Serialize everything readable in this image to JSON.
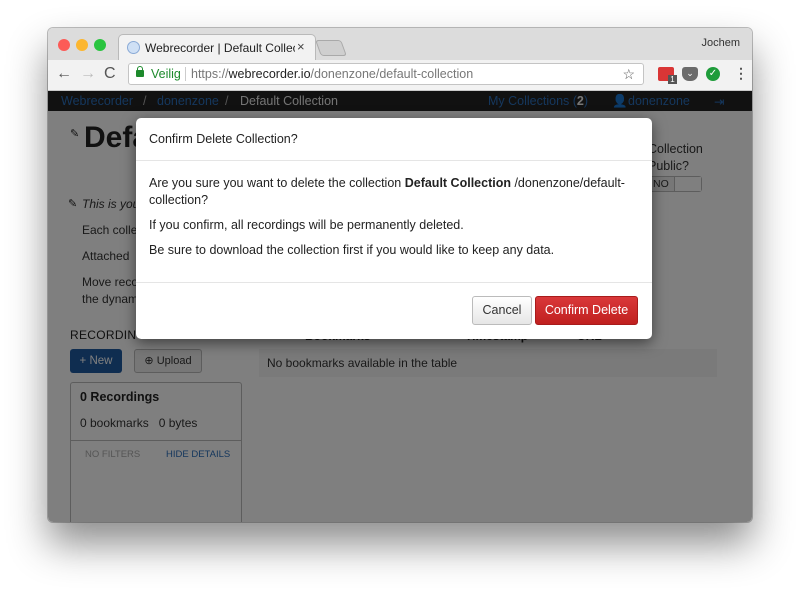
{
  "browser": {
    "tab_title": "Webrecorder | Default Collection",
    "tab_close": "×",
    "profile_name": "Jochem",
    "secure_label": "Veilig",
    "url_scheme": "https://",
    "url_host": "webrecorder.io",
    "url_path": "/donenzone/default-collection",
    "back_icon": "←",
    "forward_icon": "→",
    "reload_icon": "C",
    "star_icon": "☆",
    "menu_icon": "⋮",
    "extensions": [
      {
        "name": "calendar-extension",
        "badge": "1"
      },
      {
        "name": "pocket-extension",
        "glyph": "⌄"
      },
      {
        "name": "checkmark-extension",
        "glyph": "✓"
      }
    ]
  },
  "navbar": {
    "breadcrumbs": [
      "Webrecorder",
      "donenzone",
      "Default Collection"
    ],
    "separator": "/",
    "my_collections_label": "My Collections (",
    "my_collections_count": "2",
    "my_collections_close": ")",
    "user_label": "donenzone",
    "user_icon": "👤",
    "logout_icon": "⇥"
  },
  "page": {
    "title": "Default Collection",
    "description_italic": "This is your first collection",
    "desc_lines": [
      "Each collection",
      "Attached",
      "Move recordings",
      "the dynamic"
    ],
    "public_label_line1": "Collection",
    "public_label_line2": "Public?",
    "public_toggle_value": "NO",
    "recordings_heading": "RECORDINGS",
    "new_button": "+ New",
    "upload_button": "Upload",
    "upload_icon": "⊕",
    "recordings_count": "0 Recordings",
    "bookmarks_count": "0 bookmarks",
    "bytes_count": "0 bytes",
    "no_filters": "NO FILTERS",
    "hide_details": "HIDE DETAILS",
    "table_columns": [
      "Bookmarks",
      "Timestamp",
      "URL"
    ],
    "table_empty": "No bookmarks available in the table"
  },
  "modal": {
    "title": "Confirm Delete Collection?",
    "body_prefix": "Are you sure you want to delete the collection ",
    "collection_name": "Default Collection",
    "body_suffix": " /donenzone/default-collection?",
    "line2": "If you confirm, all recordings will be permanently deleted.",
    "line3": "Be sure to download the collection first if you would like to keep any data.",
    "cancel_label": "Cancel",
    "confirm_label": "Confirm Delete",
    "confirm_color": "#c9282a"
  }
}
